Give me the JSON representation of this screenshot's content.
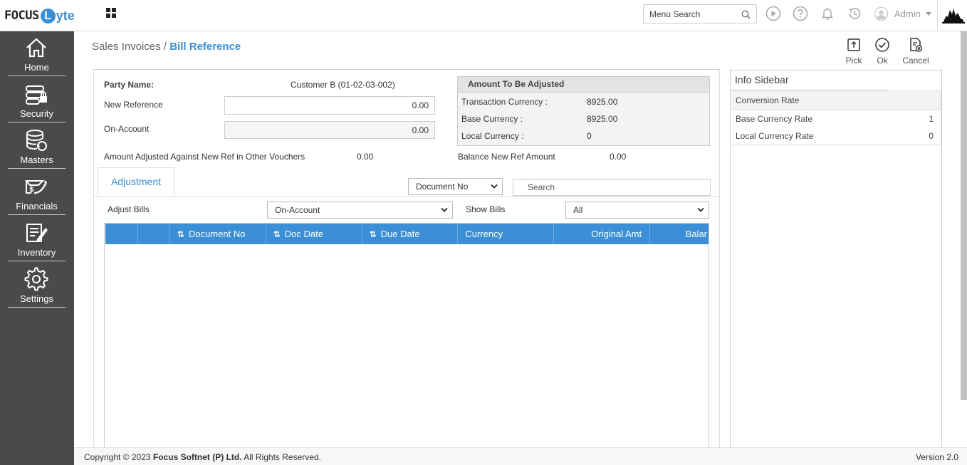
{
  "app": {
    "logo_left": "FOCUS",
    "logo_circle": "L",
    "logo_right": "yte"
  },
  "header": {
    "menu_search_placeholder": "Menu Search",
    "user_name": "Admin",
    "icons": [
      "apps-grid-icon",
      "play-icon",
      "help-icon",
      "bell-icon",
      "history-icon",
      "user-avatar-icon"
    ]
  },
  "sidebar": {
    "items": [
      {
        "label": "Home",
        "icon": "home-icon"
      },
      {
        "label": "Security",
        "icon": "security-icon"
      },
      {
        "label": "Masters",
        "icon": "database-icon"
      },
      {
        "label": "Financials",
        "icon": "financials-icon"
      },
      {
        "label": "Inventory",
        "icon": "inventory-icon"
      },
      {
        "label": "Settings",
        "icon": "gear-icon"
      }
    ]
  },
  "breadcrumb": {
    "parent": "Sales Invoices",
    "separator": " / ",
    "current": "Bill Reference"
  },
  "actions": {
    "pick": "Pick",
    "ok": "Ok",
    "cancel": "Cancel"
  },
  "form": {
    "party_name_label": "Party Name:",
    "party_name_value": "Customer B (01-02-03-002)",
    "new_reference_label": "New Reference",
    "new_reference_value": "0.00",
    "on_account_label": "On-Account",
    "on_account_value": "0.00",
    "amount_adjusted_label": "Amount Adjusted Against New Ref in Other Vouchers",
    "amount_adjusted_value": "0.00",
    "balance_new_ref_label": "Balance New Ref Amount",
    "balance_new_ref_value": "0.00"
  },
  "amount_box": {
    "title": "Amount To Be Adjusted",
    "rows": [
      {
        "label": "Transaction Currency :",
        "value": "8925.00"
      },
      {
        "label": "Base Currency :",
        "value": "8925.00"
      },
      {
        "label": "Local Currency :",
        "value": "0"
      }
    ]
  },
  "tabs": {
    "adjustment": "Adjustment"
  },
  "filters": {
    "search_by_selected": "Document No",
    "search_placeholder": "Search",
    "adjust_bills_label": "Adjust Bills",
    "adjust_bills_selected": "On-Account",
    "show_bills_label": "Show Bills",
    "show_bills_selected": "All"
  },
  "table": {
    "columns": [
      "",
      "",
      "Document No",
      "Doc Date",
      "Due Date",
      "Currency",
      "Original Amt",
      "Balar"
    ],
    "rows": []
  },
  "info_sidebar": {
    "title": "Info Sidebar",
    "section_title": "Conversion Rate",
    "rows": [
      {
        "label": "Base Currency Rate",
        "value": "1"
      },
      {
        "label": "Local Currency Rate",
        "value": "0"
      }
    ]
  },
  "footer": {
    "copyright_prefix": "Copyright © 2023",
    "company": "Focus Softnet (P) Ltd.",
    "copyright_suffix": "All Rights Reserved.",
    "version": "Version 2.0"
  },
  "colors": {
    "accent": "#3a8fd6",
    "sidebar_bg": "#4a4a4a",
    "table_header": "#3a8fd6"
  }
}
